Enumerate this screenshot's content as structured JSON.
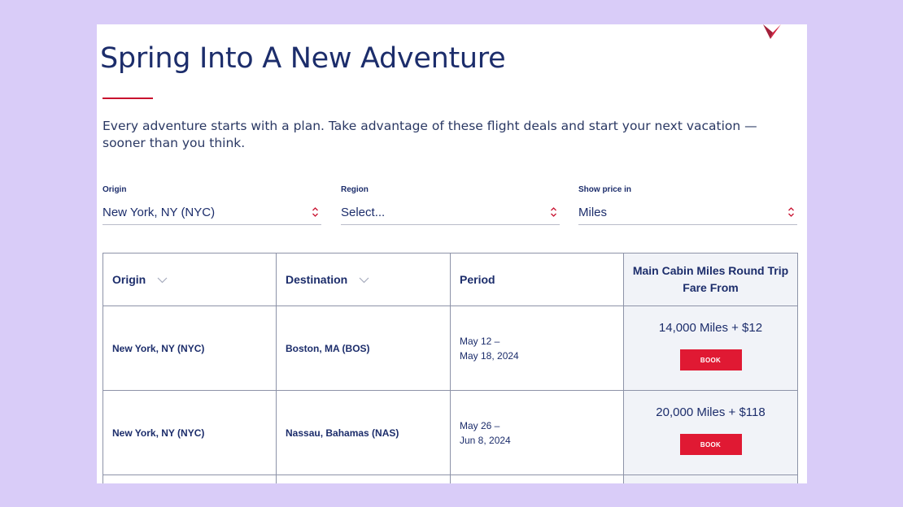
{
  "page": {
    "title": "Spring Into A New Adventure",
    "intro": "Every adventure starts with a plan. Take advantage of these flight deals and start your next vacation — sooner than you think.",
    "logo_icon": "widget-logo-icon"
  },
  "filters": {
    "origin": {
      "label": "Origin",
      "value": "New York, NY (NYC)"
    },
    "region": {
      "label": "Region",
      "value": "Select..."
    },
    "price": {
      "label": "Show price in",
      "value": "Miles"
    }
  },
  "table": {
    "headers": {
      "origin": "Origin",
      "destination": "Destination",
      "period": "Period",
      "fare": "Main Cabin Miles Round Trip Fare From"
    },
    "rows": [
      {
        "origin": "New York, NY (NYC)",
        "destination": "Boston, MA (BOS)",
        "period_start": "May 12 –",
        "period_end": "May 18, 2024",
        "fare": "14,000 Miles + $12",
        "book_label": "BOOK"
      },
      {
        "origin": "New York, NY (NYC)",
        "destination": "Nassau, Bahamas (NAS)",
        "period_start": "May 26 –",
        "period_end": "Jun 8, 2024",
        "fare": "20,000 Miles + $118",
        "book_label": "BOOK"
      }
    ]
  },
  "colors": {
    "page_background": "#d9ccf8",
    "brand_navy": "#1c2d6b",
    "accent_red": "#c8102e",
    "button_red": "#e01933",
    "fare_column_bg": "#f1f3f8"
  }
}
